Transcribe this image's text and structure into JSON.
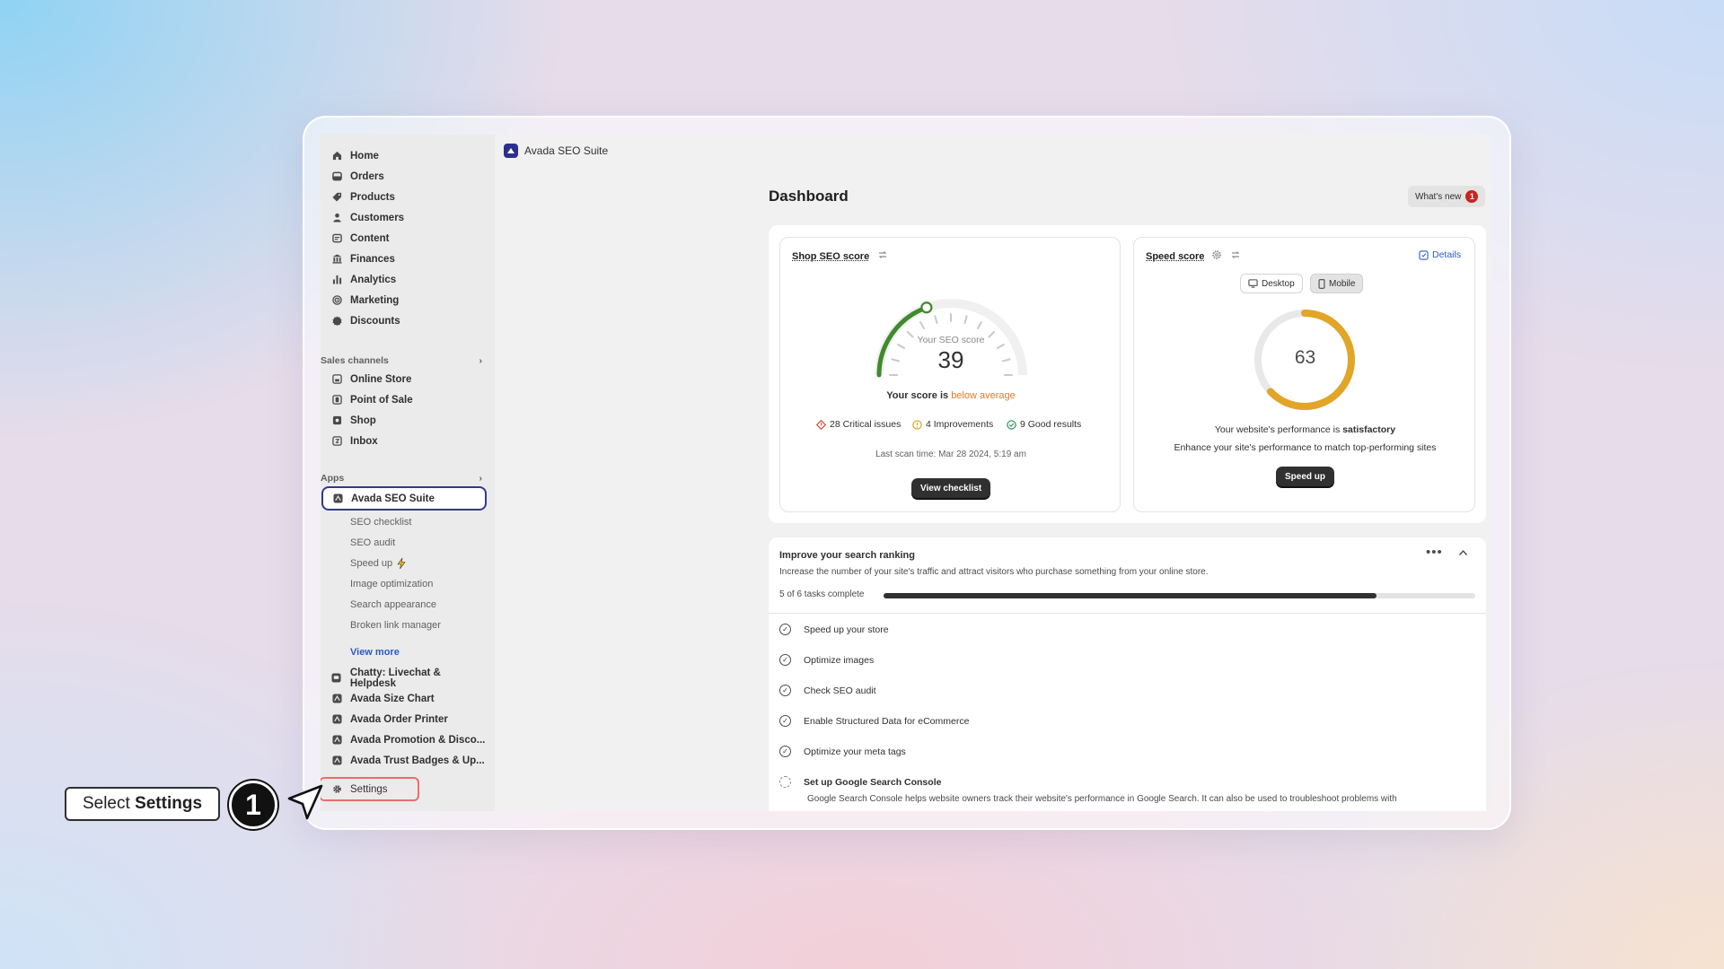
{
  "sidebar": {
    "main_items": [
      {
        "label": "Home",
        "icon": "home-icon"
      },
      {
        "label": "Orders",
        "icon": "orders-icon"
      },
      {
        "label": "Products",
        "icon": "tag-icon"
      },
      {
        "label": "Customers",
        "icon": "person-icon"
      },
      {
        "label": "Content",
        "icon": "content-icon"
      },
      {
        "label": "Finances",
        "icon": "bank-icon"
      },
      {
        "label": "Analytics",
        "icon": "chart-icon"
      },
      {
        "label": "Marketing",
        "icon": "target-icon"
      },
      {
        "label": "Discounts",
        "icon": "discount-icon"
      }
    ],
    "sales_channels_label": "Sales channels",
    "sales_channels": [
      {
        "label": "Online Store"
      },
      {
        "label": "Point of Sale"
      },
      {
        "label": "Shop"
      },
      {
        "label": "Inbox"
      }
    ],
    "apps_label": "Apps",
    "active_app": "Avada SEO Suite",
    "sub_items": [
      "SEO checklist",
      "SEO audit",
      "Speed up",
      "Image optimization",
      "Search appearance",
      "Broken link manager"
    ],
    "view_more": "View more",
    "other_apps": [
      "Chatty: Livechat & Helpdesk",
      "Avada Size Chart",
      "Avada Order Printer",
      "Avada Promotion & Disco...",
      "Avada Trust Badges & Up..."
    ],
    "settings": "Settings"
  },
  "topbar": {
    "app_name": "Avada SEO Suite"
  },
  "dashboard": {
    "title": "Dashboard",
    "whats_new": "What's new",
    "whats_new_count": "1",
    "seo": {
      "title": "Shop SEO score",
      "gauge_label": "Your SEO score",
      "score": "39",
      "score_value": 39,
      "score_text_prefix": "Your score is",
      "score_text_status": "below average",
      "critical": "28 Critical issues",
      "improvements": "4 Improvements",
      "good": "9 Good results",
      "last_scan": "Last scan time: Mar 28 2024, 5:19 am",
      "button": "View checklist"
    },
    "speed": {
      "title": "Speed score",
      "details": "Details",
      "desktop": "Desktop",
      "mobile": "Mobile",
      "score": "63",
      "score_value": 63,
      "perf_prefix": "Your website's performance is",
      "perf_status": "satisfactory",
      "enhance": "Enhance your site's performance to match top-performing sites",
      "button": "Speed up",
      "ring_color": "#e2a528"
    },
    "improve": {
      "title": "Improve your search ranking",
      "desc": "Increase the number of your site's traffic and attract visitors who purchase something from your online store.",
      "progress_text": "5 of 6 tasks complete",
      "progress_fraction": 0.833,
      "tasks": [
        "Speed up your store",
        "Optimize images",
        "Check SEO audit",
        "Enable Structured Data for eCommerce",
        "Optimize your meta tags"
      ],
      "pending_task": "Set up Google Search Console",
      "pending_desc": "Google Search Console helps website owners track their website's performance in Google Search. It can also be used to troubleshoot problems with"
    }
  },
  "callout": {
    "prefix": "Select",
    "bold": "Settings",
    "step": "1"
  },
  "colors": {
    "accent": "#2f3a8f",
    "highlight": "#ef6b6b",
    "warning": "#e07a26",
    "gauge_green": "#3f8a2a"
  }
}
